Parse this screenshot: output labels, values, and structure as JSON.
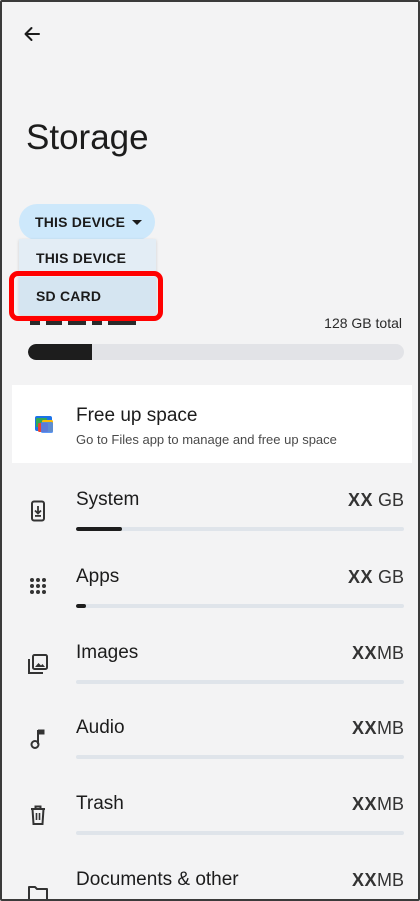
{
  "header": {
    "back_icon": "arrow-back-icon",
    "title": "Storage"
  },
  "device_selector": {
    "selected": "THIS DEVICE",
    "options": [
      "THIS DEVICE",
      "SD CARD"
    ]
  },
  "storage_summary": {
    "total_label": "128 GB total",
    "used_fraction": 0.17
  },
  "free_up_space": {
    "title": "Free up space",
    "subtitle": "Go to Files app to manage and free up space",
    "icon": "files-app-icon"
  },
  "categories": [
    {
      "label": "System",
      "size_value": "XX",
      "size_unit": " GB",
      "fill_fraction": 0.14,
      "icon": "system-icon"
    },
    {
      "label": "Apps",
      "size_value": "XX",
      "size_unit": " GB",
      "fill_fraction": 0.03,
      "icon": "apps-grid-icon"
    },
    {
      "label": "Images",
      "size_value": "XX",
      "size_unit": "MB",
      "fill_fraction": 0,
      "icon": "images-icon"
    },
    {
      "label": "Audio",
      "size_value": "XX",
      "size_unit": "MB",
      "fill_fraction": 0,
      "icon": "music-note-icon"
    },
    {
      "label": "Trash",
      "size_value": "XX",
      "size_unit": "MB",
      "fill_fraction": 0,
      "icon": "trash-icon"
    },
    {
      "label": "Documents & other",
      "size_value": "XX",
      "size_unit": "MB",
      "fill_fraction": 0,
      "icon": "folder-icon"
    }
  ],
  "colors": {
    "accent_chip": "#cde8fb",
    "highlight": "#ff0000",
    "bar_fill": "#1d1d1d"
  }
}
